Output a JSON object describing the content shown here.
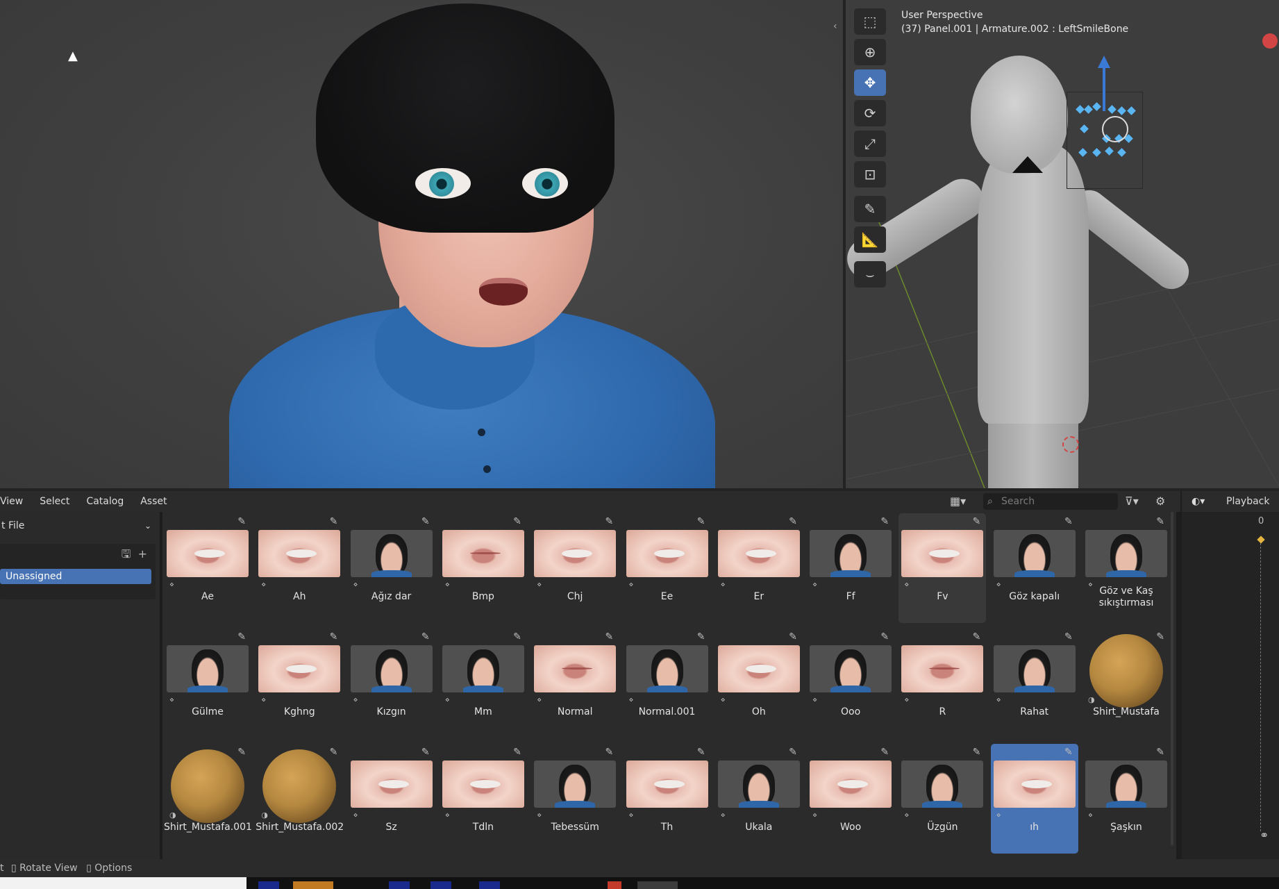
{
  "viewport_right": {
    "mode": "User Perspective",
    "context": "(37) Panel.001 | Armature.002 : LeftSmileBone"
  },
  "tools": [
    {
      "name": "select-box-tool",
      "glyph": "⬚",
      "active": false
    },
    {
      "name": "cursor-tool",
      "glyph": "⊕",
      "active": false
    },
    {
      "name": "move-tool",
      "glyph": "✥",
      "active": true
    },
    {
      "name": "rotate-tool",
      "glyph": "⟳",
      "active": false
    },
    {
      "name": "scale-tool",
      "glyph": "⤢",
      "active": false
    },
    {
      "name": "transform-tool",
      "glyph": "⊡",
      "active": false
    },
    {
      "name": "annotate-tool",
      "glyph": "✎",
      "active": false
    },
    {
      "name": "measure-tool",
      "glyph": "📐",
      "active": false
    },
    {
      "name": "roll-tool",
      "glyph": "⌣",
      "active": false
    }
  ],
  "asset_browser": {
    "menus": [
      "View",
      "Select",
      "Catalog",
      "Asset"
    ],
    "search_placeholder": "Search",
    "library": "t File",
    "catalog_item": "Unassigned",
    "assets": [
      {
        "label": "Ae",
        "thumb": "lips"
      },
      {
        "label": "Ah",
        "thumb": "lips"
      },
      {
        "label": "Ağız dar",
        "thumb": "face"
      },
      {
        "label": "Bmp",
        "thumb": "lips closed"
      },
      {
        "label": "Chj",
        "thumb": "lips"
      },
      {
        "label": "Ee",
        "thumb": "lips"
      },
      {
        "label": "Er",
        "thumb": "lips"
      },
      {
        "label": "Ff",
        "thumb": "face"
      },
      {
        "label": "Fv",
        "thumb": "lips",
        "state": "hover"
      },
      {
        "label": "Göz kapalı",
        "thumb": "face"
      },
      {
        "label": "Göz ve Kaş sıkıştırması",
        "thumb": "face"
      },
      {
        "label": "Gülme",
        "thumb": "face"
      },
      {
        "label": "Kghng",
        "thumb": "lips"
      },
      {
        "label": "Kızgın",
        "thumb": "face"
      },
      {
        "label": "Mm",
        "thumb": "face"
      },
      {
        "label": "Normal",
        "thumb": "lips closed"
      },
      {
        "label": "Normal.001",
        "thumb": "face"
      },
      {
        "label": "Oh",
        "thumb": "lips"
      },
      {
        "label": "Ooo",
        "thumb": "face"
      },
      {
        "label": "R",
        "thumb": "lips closed"
      },
      {
        "label": "Rahat",
        "thumb": "face"
      },
      {
        "label": "Shirt_Mustafa",
        "thumb": "ball",
        "kind": "material"
      },
      {
        "label": "Shirt_Mustafa.001",
        "thumb": "ball",
        "kind": "material"
      },
      {
        "label": "Shirt_Mustafa.002",
        "thumb": "ball",
        "kind": "material"
      },
      {
        "label": "Sz",
        "thumb": "lips"
      },
      {
        "label": "Tdln",
        "thumb": "lips"
      },
      {
        "label": "Tebessüm",
        "thumb": "face"
      },
      {
        "label": "Th",
        "thumb": "lips"
      },
      {
        "label": "Ukala",
        "thumb": "face"
      },
      {
        "label": "Woo",
        "thumb": "lips"
      },
      {
        "label": "Üzgün",
        "thumb": "face"
      },
      {
        "label": "ıh",
        "thumb": "lips",
        "state": "selected"
      },
      {
        "label": "Şaşkın",
        "thumb": "face"
      }
    ]
  },
  "timeline": {
    "menu": "Playback",
    "current_frame": "0"
  },
  "statusbar": {
    "item1": "t",
    "item2": "Rotate View",
    "item3": "Options"
  },
  "colors": {
    "accent": "#4772b3",
    "panel_bg": "#2b2b2b",
    "viewport_bg": "#3d3d3d"
  }
}
